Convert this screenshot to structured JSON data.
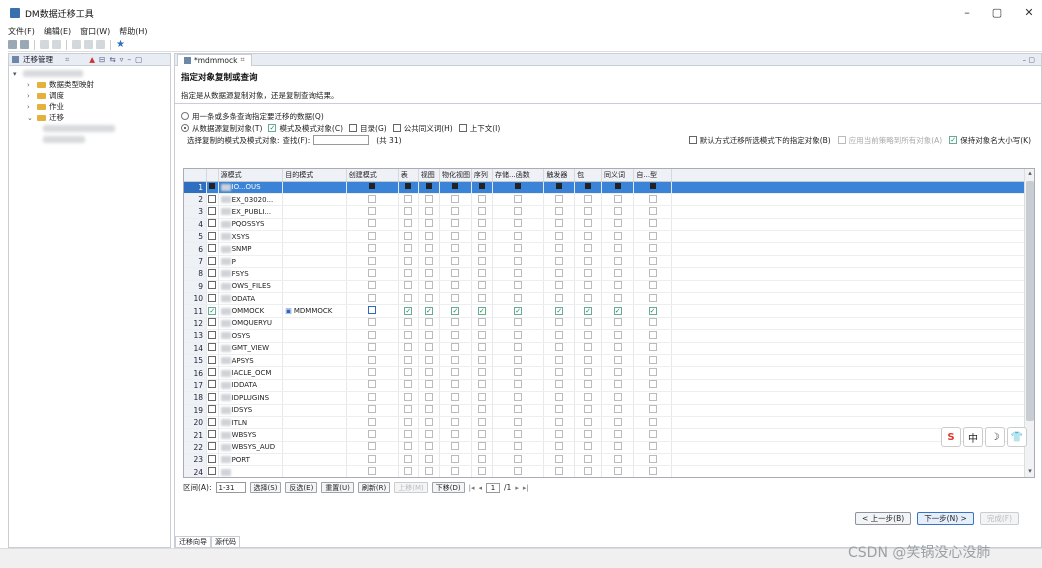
{
  "window": {
    "title": "DM数据迁移工具"
  },
  "menu": [
    "文件(F)",
    "编辑(E)",
    "窗口(W)",
    "帮助(H)"
  ],
  "left_panel": {
    "tab_label": "迁移管理",
    "tree": [
      {
        "label": "数据类型映射"
      },
      {
        "label": "调度"
      },
      {
        "label": "作业"
      },
      {
        "label": "迁移"
      }
    ]
  },
  "editor": {
    "tab_label": "*mdmmock",
    "wizard_title": "指定对象复制或查询",
    "wizard_desc": "指定是从数据源复制对象，还是复制查询结果。",
    "opt_query": "用一条或多条查询指定要迁移的数据(Q)",
    "opt_copy": "从数据源复制对象(T)",
    "cb_schema": "模式及模式对象(C)",
    "cb_catalog": "目录(G)",
    "cb_public_syn": "公共同义词(H)",
    "cb_context": "上下文(I)",
    "select_label": "选择复制的模式及模式对象:",
    "find_label": "查找(F):",
    "count_text": "(共 31)",
    "cb_default": "默认方式迁移所选模式下的指定对象(B)",
    "cb_apply_all": "应用当前策略到所有对象(A)",
    "cb_keep_case": "保持对象名大小写(K)"
  },
  "table": {
    "headers": [
      "",
      "",
      "源模式",
      "目的模式",
      "创建模式",
      "表",
      "视图",
      "物化视图",
      "序列",
      "存储...函数",
      "触发器",
      "包",
      "同义词",
      "自...型"
    ],
    "rows": [
      {
        "n": "1",
        "src": "IO...OUS",
        "dst": ""
      },
      {
        "n": "2",
        "src": "EX_03020...",
        "dst": ""
      },
      {
        "n": "3",
        "src": "EX_PUBLI...",
        "dst": ""
      },
      {
        "n": "4",
        "src": "PQOSSYS",
        "dst": ""
      },
      {
        "n": "5",
        "src": "XSYS",
        "dst": ""
      },
      {
        "n": "6",
        "src": "SNMP",
        "dst": ""
      },
      {
        "n": "7",
        "src": "P",
        "dst": ""
      },
      {
        "n": "8",
        "src": "FSYS",
        "dst": ""
      },
      {
        "n": "9",
        "src": "OWS_FILES",
        "dst": ""
      },
      {
        "n": "10",
        "src": "ODATA",
        "dst": ""
      },
      {
        "n": "11",
        "src": "OMMOCK",
        "dst": "MDMMOCK"
      },
      {
        "n": "12",
        "src": "OMQUERYU",
        "dst": ""
      },
      {
        "n": "13",
        "src": "OSYS",
        "dst": ""
      },
      {
        "n": "14",
        "src": "GMT_VIEW",
        "dst": ""
      },
      {
        "n": "15",
        "src": "APSYS",
        "dst": ""
      },
      {
        "n": "16",
        "src": "IACLE_OCM",
        "dst": ""
      },
      {
        "n": "17",
        "src": "IDDATA",
        "dst": ""
      },
      {
        "n": "18",
        "src": "IDPLUGINS",
        "dst": ""
      },
      {
        "n": "19",
        "src": "IDSYS",
        "dst": ""
      },
      {
        "n": "20",
        "src": "ITLN",
        "dst": ""
      },
      {
        "n": "21",
        "src": "WBSYS",
        "dst": ""
      },
      {
        "n": "22",
        "src": "WBSYS_AUD",
        "dst": ""
      },
      {
        "n": "23",
        "src": "PORT",
        "dst": ""
      },
      {
        "n": "24",
        "src": "",
        "dst": ""
      }
    ]
  },
  "bottom": {
    "range_label": "区间(A):",
    "range_value": "1-31",
    "btn_select": "选择(S)",
    "btn_invert": "反选(E)",
    "btn_reset": "重置(U)",
    "btn_refresh": "刷新(R)",
    "btn_up": "上移(M)",
    "btn_down": "下移(D)",
    "page_value": "1",
    "page_total": "/1"
  },
  "wizard_buttons": {
    "back": "< 上一步(B)",
    "next": "下一步(N) >",
    "finish": "完成(F)"
  },
  "bottom_tabs": [
    "迁移向导",
    "源代码"
  ],
  "watermark": "CSDN @笑锅没心没肺",
  "ime": [
    "S",
    "中",
    "☽",
    "👕"
  ]
}
